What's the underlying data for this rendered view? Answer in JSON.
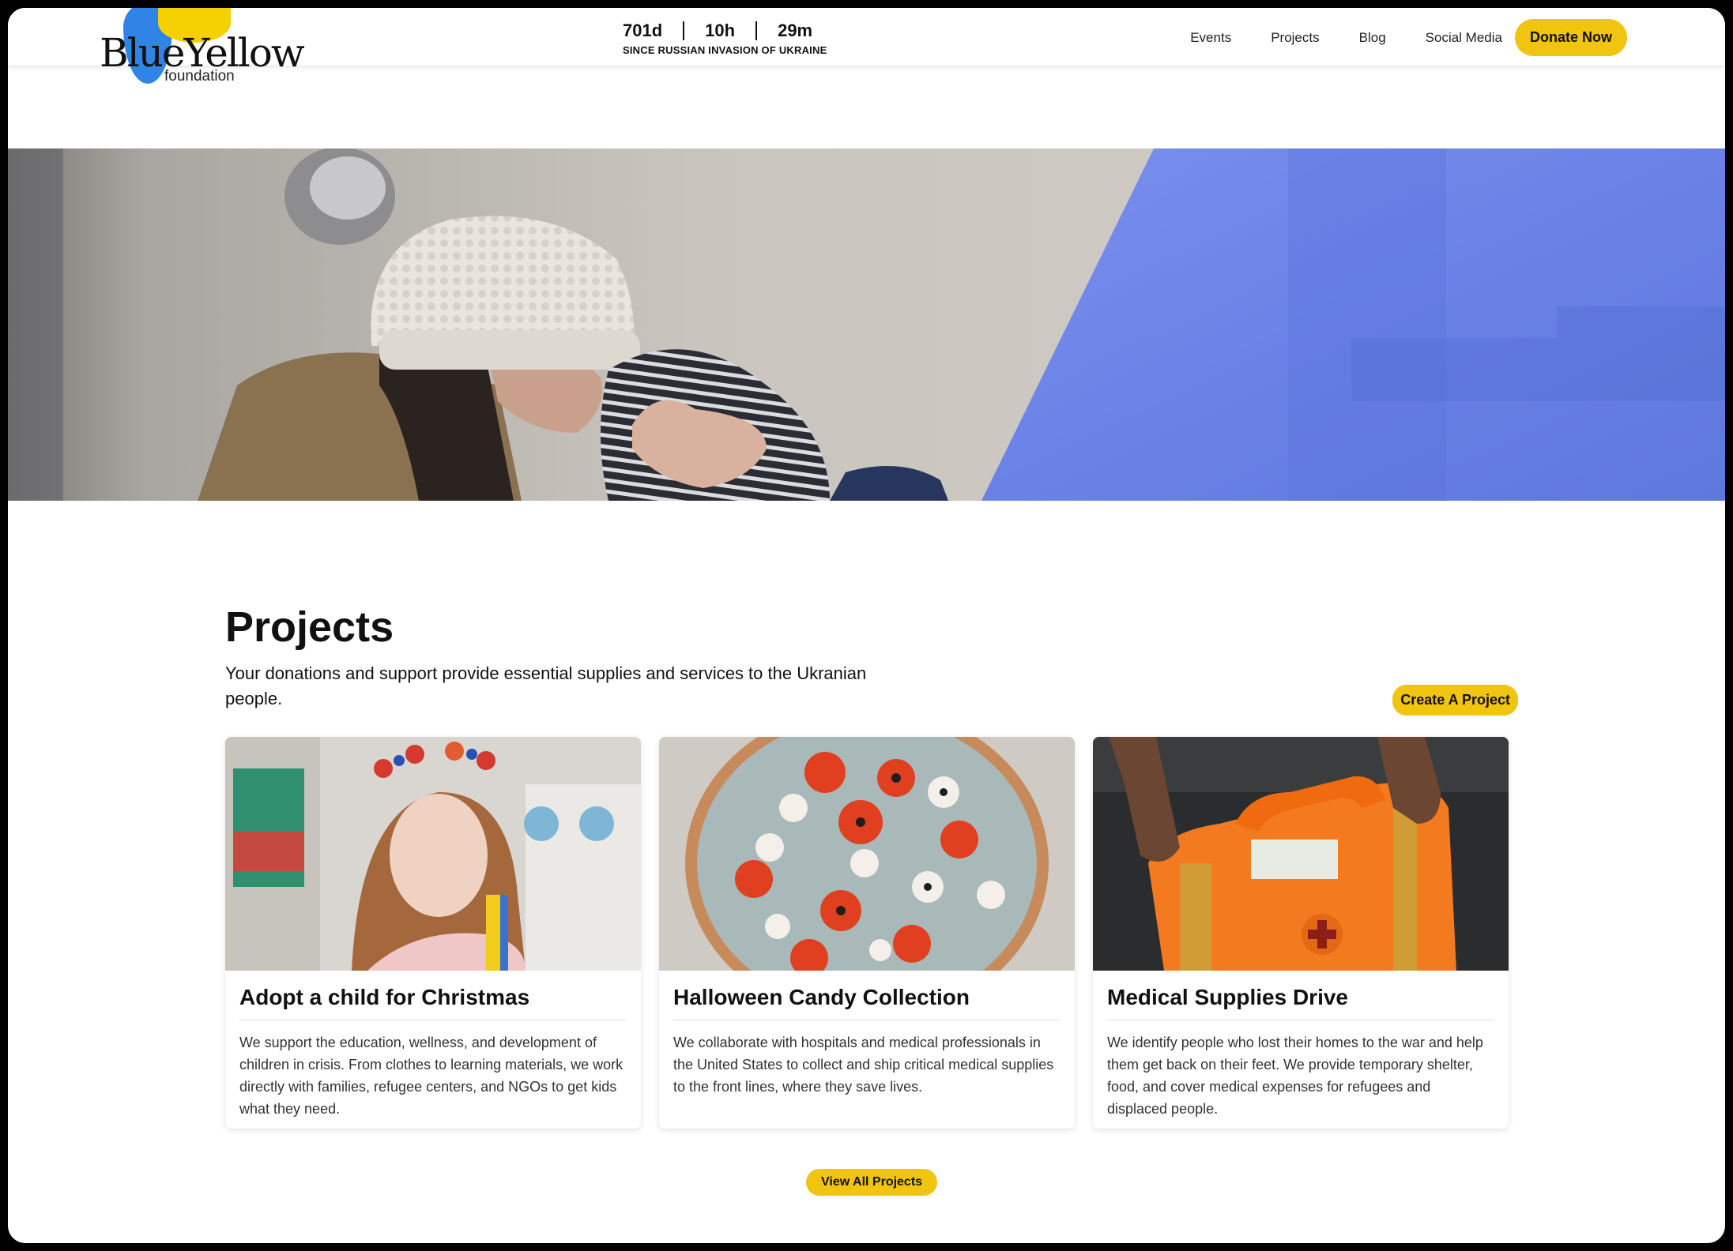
{
  "header": {
    "logo": {
      "word_blue": "Blue",
      "word_yellow": "Yellow",
      "sub": "foundation"
    },
    "counter": {
      "days": "701d",
      "hours": "10h",
      "minutes": "29m",
      "caption": "SINCE RUSSIAN INVASION OF UKRAINE"
    },
    "nav": [
      {
        "label": "Events"
      },
      {
        "label": "Projects"
      },
      {
        "label": "Blog"
      },
      {
        "label": "Social Media"
      }
    ],
    "donate_label": "Donate Now"
  },
  "colors": {
    "accent_yellow": "#f1c40f",
    "hero_blue": "#6f86e8",
    "logo_blue": "#2f84e6",
    "logo_yellow": "#f4d000"
  },
  "projects": {
    "title": "Projects",
    "intro": "Your donations and support provide essential supplies and services to the Ukranian people.",
    "create_label": "Create A Project",
    "view_all_label": "View All Projects",
    "cards": [
      {
        "title": "Adopt a child for Christmas",
        "text": "We support the education, wellness, and development of children in crisis. From clothes to learning materials, we work directly with families, refugee centers, and NGOs to get kids what they need."
      },
      {
        "title": "Halloween Candy Collection",
        "text": "We collaborate with hospitals and medical professionals in the United States to collect and ship critical medical supplies to the front lines, where they save lives."
      },
      {
        "title": "Medical Supplies Drive",
        "text": "We identify people who lost their homes to the war and help them get back on their feet. We provide temporary shelter, food, and cover medical expenses for refugees and displaced people."
      }
    ]
  }
}
